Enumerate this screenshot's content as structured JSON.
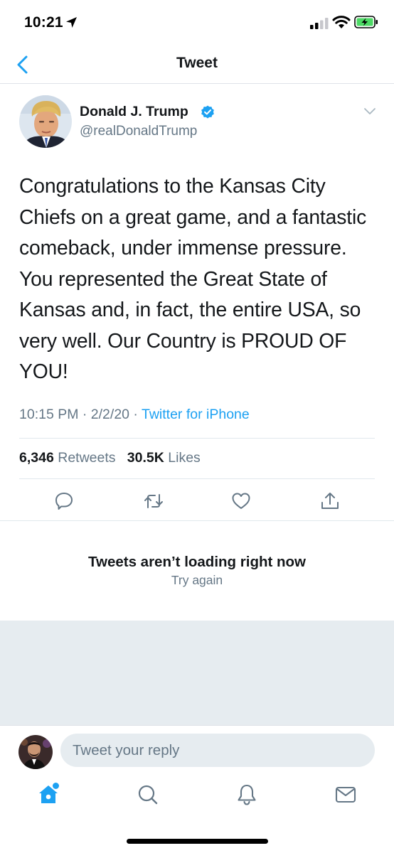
{
  "status_bar": {
    "time": "10:21"
  },
  "nav": {
    "title": "Tweet"
  },
  "tweet": {
    "author_name": "Donald J. Trump",
    "handle": "@realDonaldTrump",
    "text": "Congratulations to the Kansas City Chiefs on a great game, and a fantastic comeback, under immense pressure. You represented the Great State of Kansas and, in fact, the entire USA, so very well. Our Country is PROUD OF YOU!",
    "timestamp": "10:15 PM · 2/2/20 · ",
    "source": "Twitter for iPhone",
    "retweets_count": "6,346",
    "retweets_label": "Retweets",
    "likes_count": "30.5K",
    "likes_label": "Likes"
  },
  "replies": {
    "error_title": "Tweets aren’t loading right now",
    "retry_label": "Try again"
  },
  "reply_bar": {
    "placeholder": "Tweet your reply"
  },
  "colors": {
    "accent": "#1da1f2",
    "secondary_text": "#657786",
    "primary_text": "#14171a",
    "gray_background": "#e6ecf0"
  },
  "icons": [
    "location-arrow-icon",
    "signal-icon",
    "wifi-icon",
    "battery-charging-icon",
    "back-chevron-icon",
    "verified-badge-icon",
    "chevron-down-icon",
    "reply-icon",
    "retweet-icon",
    "like-icon",
    "share-icon",
    "home-icon",
    "search-icon",
    "notifications-icon",
    "messages-icon"
  ]
}
